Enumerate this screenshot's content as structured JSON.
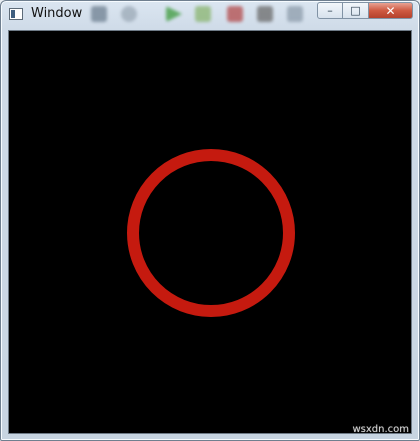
{
  "window": {
    "title": "Window"
  },
  "controls": {
    "minimize": "–",
    "maximize": "□",
    "close": "✕"
  },
  "canvas": {
    "background_color": "#000000",
    "circle_color": "#c51a0f"
  },
  "watermark": "wsxdn.com",
  "icons": {
    "app": "app-window-icon",
    "minimize": "minimize-icon",
    "maximize": "maximize-icon",
    "close": "close-icon"
  }
}
